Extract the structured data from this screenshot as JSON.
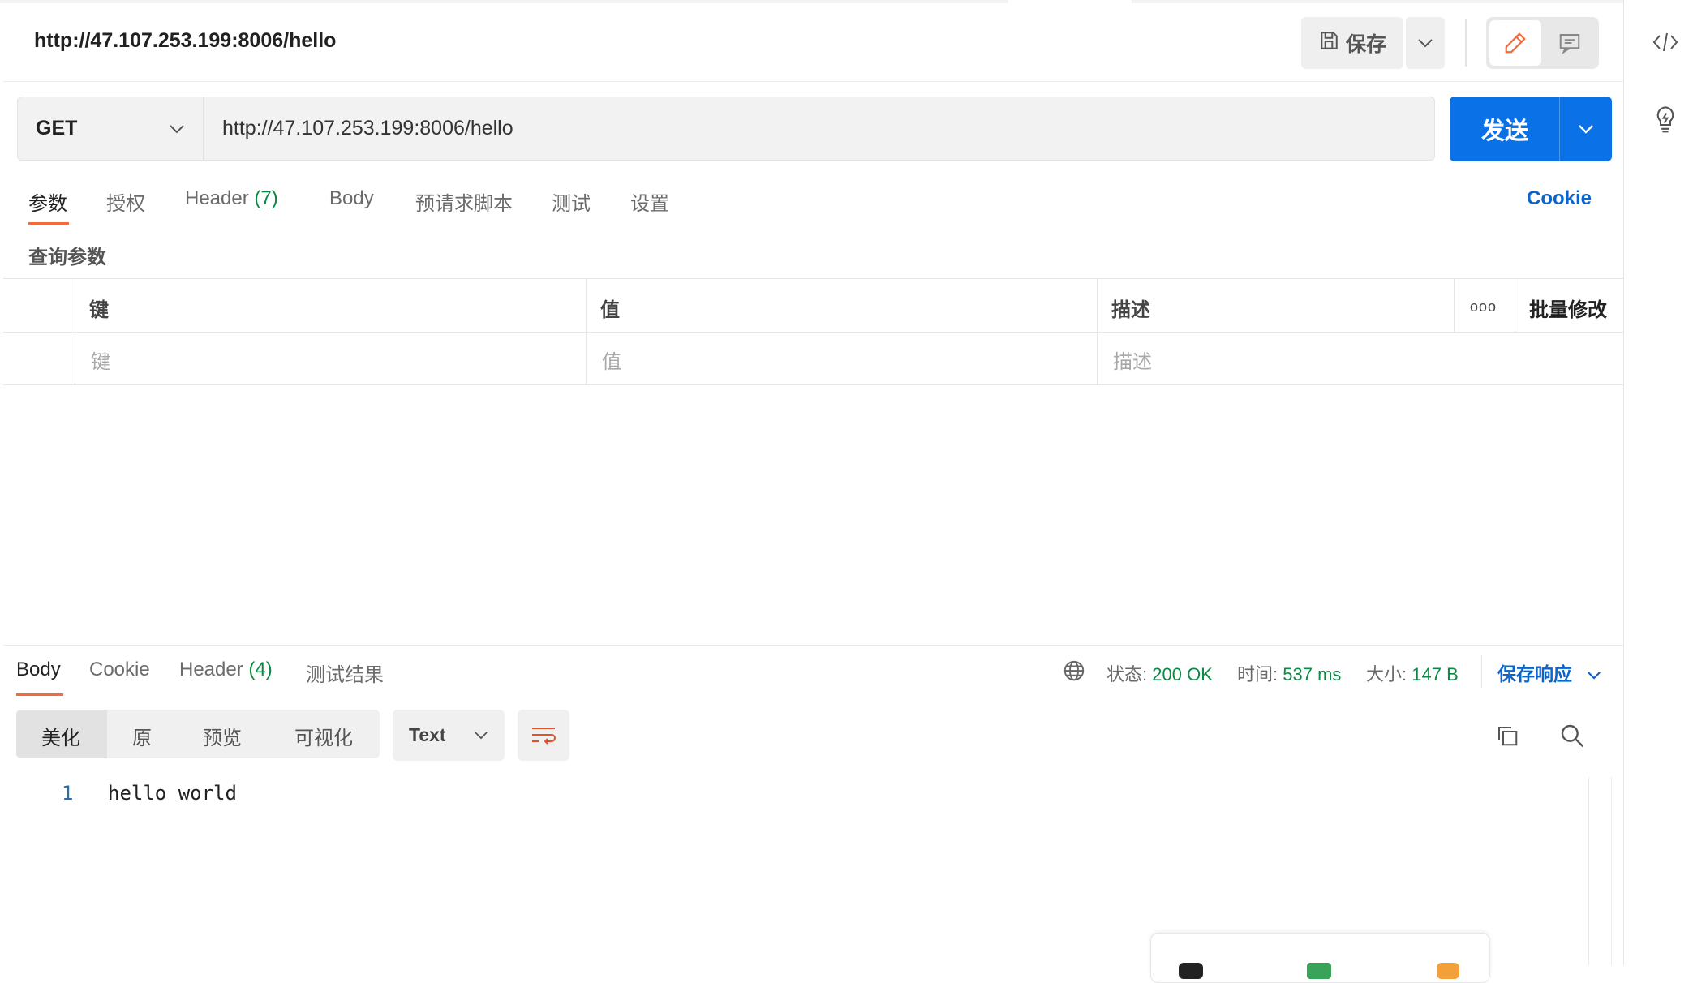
{
  "request": {
    "title": "http://47.107.253.199:8006/hello",
    "method": "GET",
    "url": "http://47.107.253.199:8006/hello",
    "save_label": "保存",
    "send_label": "发送"
  },
  "request_tabs": [
    {
      "label": "参数"
    },
    {
      "label": "授权"
    },
    {
      "label": "Header",
      "count": "(7)"
    },
    {
      "label": "Body"
    },
    {
      "label": "预请求脚本"
    },
    {
      "label": "测试"
    },
    {
      "label": "设置"
    }
  ],
  "cookie_link": "Cookie",
  "params": {
    "section_title": "查询参数",
    "columns": [
      "键",
      "值",
      "描述"
    ],
    "more": "ooo",
    "bulk_edit": "批量修改",
    "placeholders": [
      "键",
      "值",
      "描述"
    ]
  },
  "response": {
    "tabs": [
      {
        "label": "Body"
      },
      {
        "label": "Cookie"
      },
      {
        "label": "Header",
        "count": "(4)"
      },
      {
        "label": "测试结果"
      }
    ],
    "status_label": "状态:",
    "status_value": "200 OK",
    "time_label": "时间:",
    "time_value": "537 ms",
    "size_label": "大小:",
    "size_value": "147 B",
    "save_response": "保存响应",
    "view_modes": [
      "美化",
      "原",
      "预览",
      "可视化"
    ],
    "format": "Text",
    "line_number": "1",
    "body_text": "hello world"
  },
  "colors": {
    "accent": "#f26b3a",
    "send": "#0a72e6",
    "link": "#0a65cc",
    "success": "#0c8a45"
  }
}
